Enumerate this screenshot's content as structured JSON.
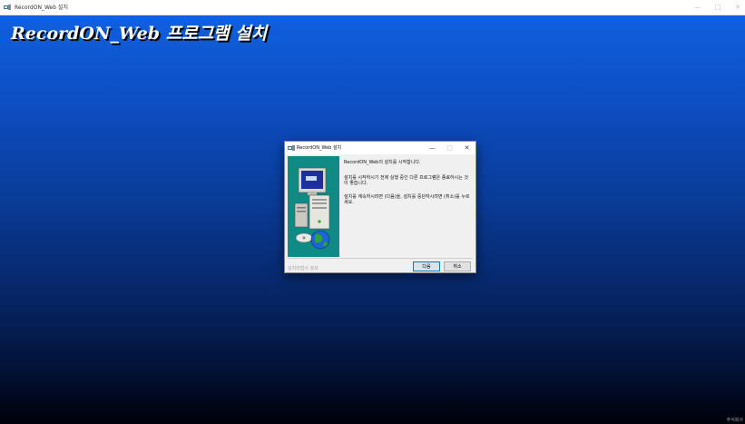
{
  "window": {
    "title": "RecordON_Web 설치",
    "controls": [
      "—",
      "□",
      "✕"
    ]
  },
  "banner": {
    "title": "RecordON_Web 프로그램 설치"
  },
  "corner_text": "주식회사",
  "dialog": {
    "title": "RecordON_Web 설치",
    "controls": [
      "—",
      "□",
      "✕"
    ],
    "message_intro": "RecordON_Web의 설치를 시작합니다.",
    "message_close_programs": "설치를 시작하시기 전에 실행 중인 다른 프로그램은 종료하시는 것이 좋습니다.",
    "message_instructions": "설치를 계속하시려면 (다음)을, 설치를 중단하시려면 (취소)를 누르세요.",
    "footer_label": "설치마법사 정보",
    "next_label": "다음",
    "cancel_label": "취소"
  },
  "colors": {
    "backdrop_top": "#1060e0",
    "backdrop_bottom": "#000008",
    "side_image_bg": "#0f8a84"
  }
}
